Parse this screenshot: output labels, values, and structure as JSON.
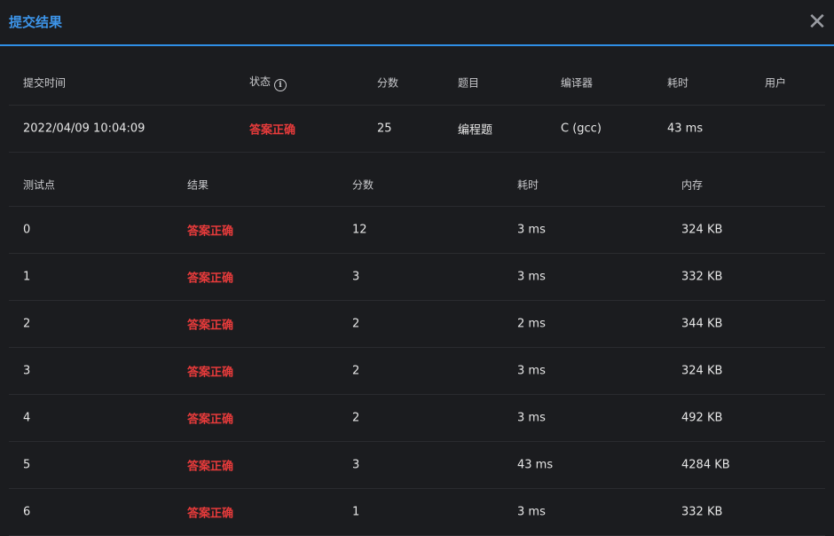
{
  "dialog": {
    "title": "提交结果",
    "close_icon": "close-icon"
  },
  "summary": {
    "headers": [
      "提交时间",
      "状态",
      "分数",
      "题目",
      "编译器",
      "耗时",
      "用户"
    ],
    "row": {
      "time": "2022/04/09 10:04:09",
      "status": "答案正确",
      "score": "25",
      "problem": "编程题",
      "compiler": "C (gcc)",
      "duration": "43 ms",
      "user": ""
    }
  },
  "tests": {
    "headers": [
      "测试点",
      "结果",
      "分数",
      "耗时",
      "内存"
    ],
    "rows": [
      {
        "id": "0",
        "result": "答案正确",
        "score": "12",
        "time": "3 ms",
        "memory": "324 KB"
      },
      {
        "id": "1",
        "result": "答案正确",
        "score": "3",
        "time": "3 ms",
        "memory": "332 KB"
      },
      {
        "id": "2",
        "result": "答案正确",
        "score": "2",
        "time": "2 ms",
        "memory": "344 KB"
      },
      {
        "id": "3",
        "result": "答案正确",
        "score": "2",
        "time": "3 ms",
        "memory": "324 KB"
      },
      {
        "id": "4",
        "result": "答案正确",
        "score": "2",
        "time": "3 ms",
        "memory": "492 KB"
      },
      {
        "id": "5",
        "result": "答案正确",
        "score": "3",
        "time": "43 ms",
        "memory": "4284 KB"
      },
      {
        "id": "6",
        "result": "答案正确",
        "score": "1",
        "time": "3 ms",
        "memory": "332 KB"
      }
    ]
  },
  "colors": {
    "accent": "#3d95ea",
    "accepted": "#e83b3b",
    "background": "#1b1c1f"
  }
}
